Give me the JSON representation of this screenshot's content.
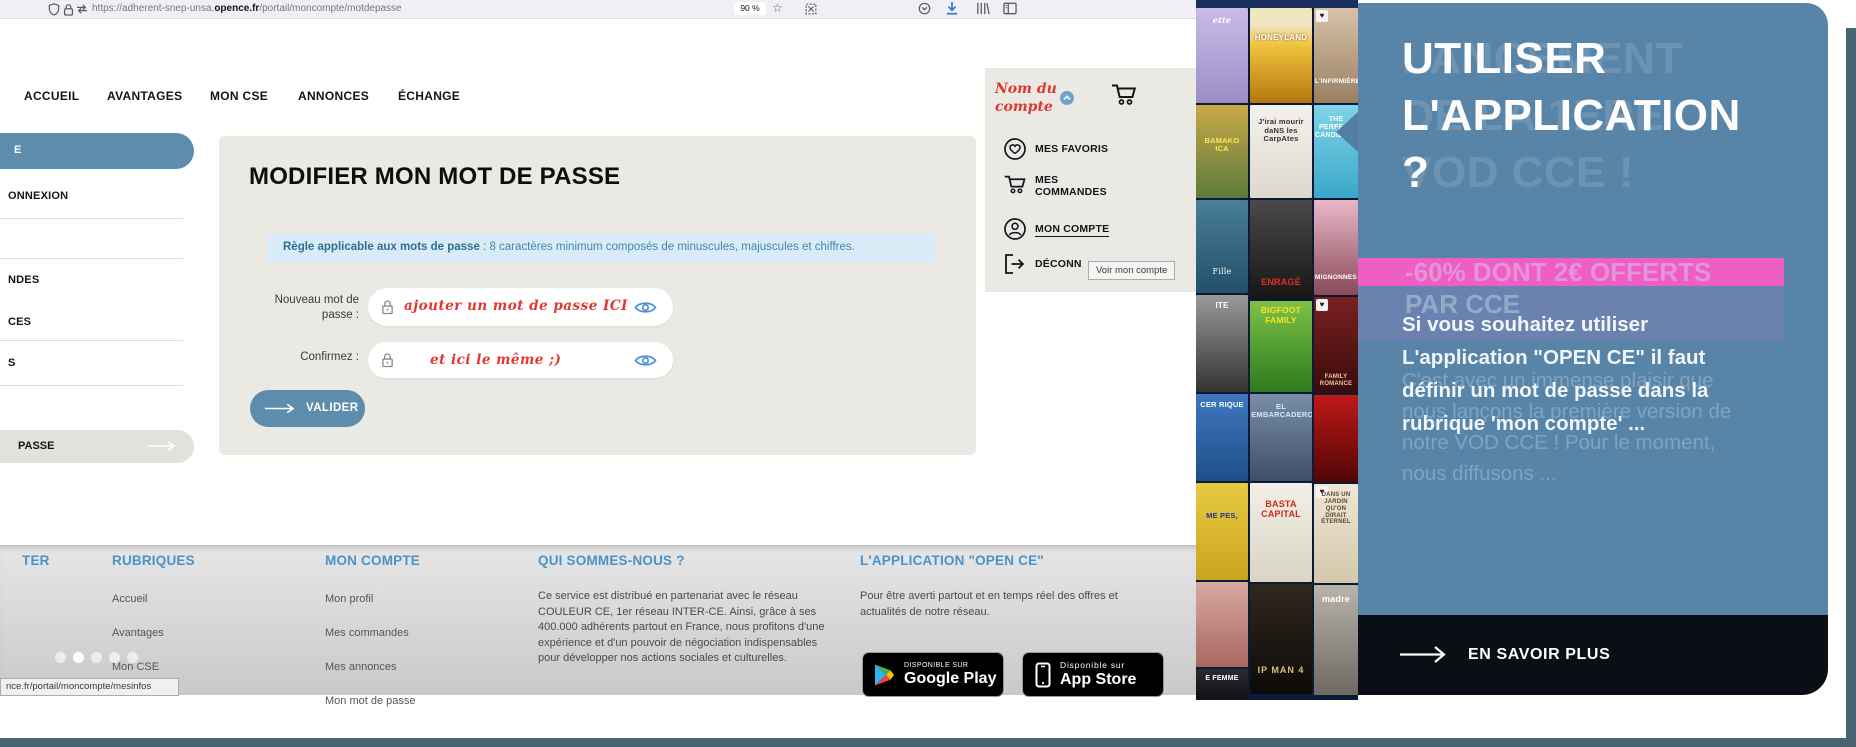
{
  "browser": {
    "url_prefix": "https://adherent-snep-unsa.",
    "url_domain": "opence.fr",
    "url_path": "/portail/moncompte/motdepasse",
    "zoom_level": "90 %",
    "status_tooltip": "nce.fr/portail/moncompte/mesinfos"
  },
  "nav": {
    "items": [
      "ACCUEIL",
      "AVANTAGES",
      "MON CSE",
      "ANNONCES",
      "ÉCHANGE"
    ]
  },
  "account": {
    "name_line1": "Nom du",
    "name_line2": "compte",
    "favorites": "MES FAVORIS",
    "orders_line1": "MES",
    "orders_line2": "COMMANDES",
    "profile": "MON COMPTE",
    "logout": "DÉCONN",
    "tooltip": "Voir mon compte"
  },
  "sidebar": {
    "active_item": "E",
    "item1": "ONNEXION",
    "item2": "NDES",
    "item3": "CES",
    "item4": "S",
    "password_item": "PASSE"
  },
  "card": {
    "title": "MODIFIER MON MOT DE PASSE",
    "rule_bold": "Règle applicable aux mots de passe",
    "rule_rest": " : 8 caractères minimum composés de minuscules, majuscules et chiffres.",
    "label1a": "Nouveau mot de",
    "label1b": "passe :",
    "placeholder1": "ajouter un mot de passe ICI",
    "label2": "Confirmez :",
    "placeholder2": "et ici le même ;)",
    "submit": "VALIDER"
  },
  "footer": {
    "contact_fragment": "TER",
    "rubriques_title": "RUBRIQUES",
    "rubriques": [
      "Accueil",
      "Avantages",
      "Mon CSE"
    ],
    "compte_title": "MON COMPTE",
    "compte": [
      "Mon profil",
      "Mes commandes",
      "Mes annonces",
      "Mon mot de passe"
    ],
    "about_title": "QUI SOMMES-NOUS ?",
    "about_text": "Ce service est distribué en partenariat avec le réseau COULEUR CE, 1er réseau INTER-CE. Ainsi, grâce à ses 400.000 adhérents partout en France, nous profitons d'une expérience et d'un pouvoir de négociation indispensables pour développer nos actions sociales et culturelles.",
    "app_title": "L'APPLICATION \"OPEN CE\"",
    "app_text": "Pour être averti partout et en temps réel des offres et actualités de notre réseau.",
    "gp_line1": "DISPONIBLE SUR",
    "gp_line2": "Google Play",
    "as_line1": "Disponible sur",
    "as_line2": "App Store"
  },
  "promo": {
    "title1": "UTILISER",
    "title2": "L'APPLICATION",
    "title3": "?",
    "ghost1": "LANCEMENT",
    "ghost2": "DE LA 1ERE",
    "ghost3": "VOD CCE !",
    "ghost_sub1": "-60% DONT 2€ OFFERTS",
    "ghost_sub2": "PAR CCE",
    "body1": "Si vous souhaitez utiliser",
    "body2": "L'application \"OPEN CE\" il faut",
    "body3": "définir un mot de passe dans la",
    "body4": "rubrique 'mon compte' ...",
    "gbody1": "C'est avec un immense plaisir que",
    "gbody2": "nous lançons la première version de",
    "gbody3": "notre VOD CCE ! Pour le moment,",
    "gbody4": "nous diffusons ...",
    "cta": "EN SAVOIR PLUS"
  },
  "posters": {
    "col1": [
      "ette",
      "BAMAKO ICA",
      "Fille",
      "ITE",
      "CER RIQUE",
      "ME PES,",
      "",
      "E FEMME"
    ],
    "col2": [
      "HONEYLAND",
      "J'irai mourir daNS les CarpAtes",
      "ENRAGÉ",
      "BIGFOOT FAMILY",
      "EL EMBARCADERO",
      "BASTA CAPITAL",
      "IP MAN 4"
    ],
    "col3": [
      "L'INFIRMIÈRE",
      "THE PERFECT CANDIDATE",
      "MIGNONNES",
      "FAMILY ROMANCE",
      "",
      "DANS UN JARDIN QU'ON DIRAIT ÉTERNEL",
      "madre"
    ]
  }
}
